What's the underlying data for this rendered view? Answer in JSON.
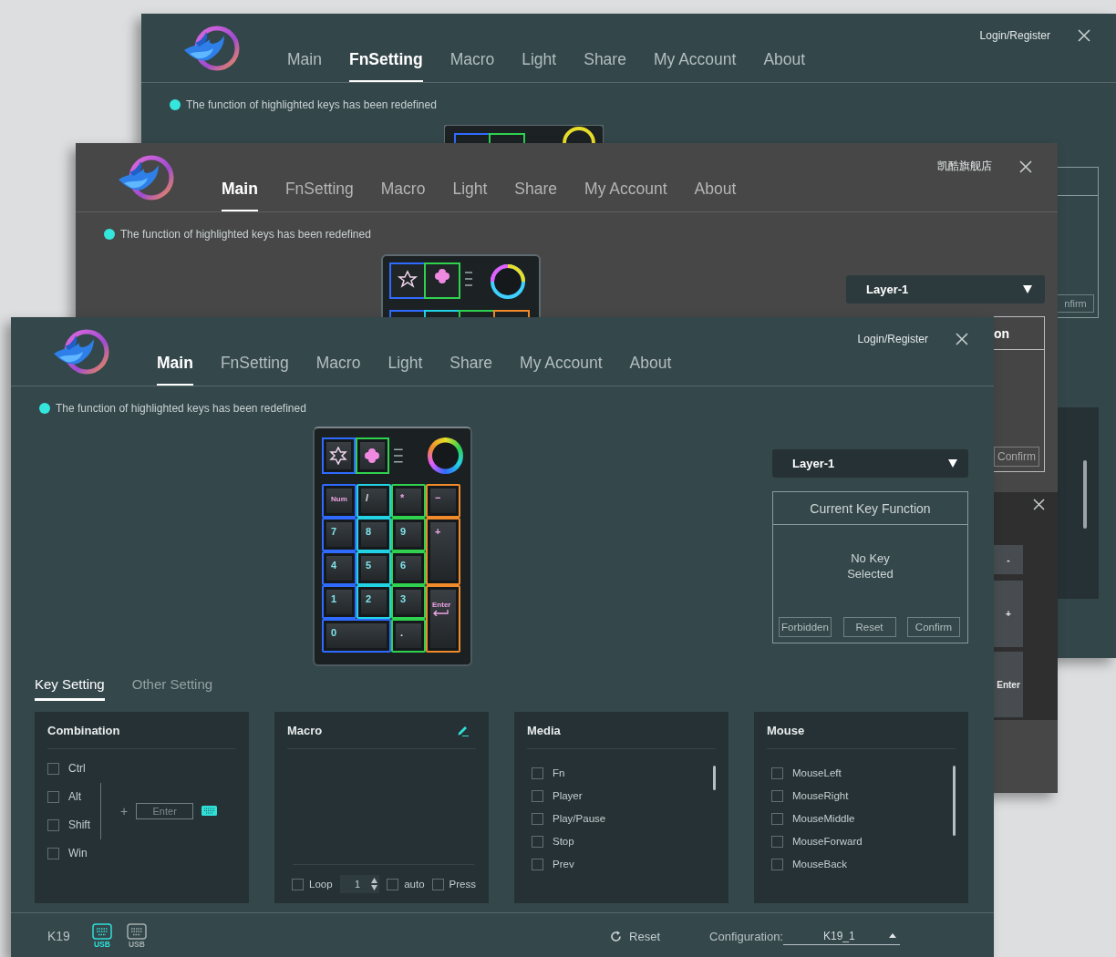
{
  "windows": [
    {
      "kind": "back",
      "tabs": [
        {
          "label": "Main",
          "selected": false
        },
        {
          "label": "FnSetting",
          "selected": true
        },
        {
          "label": "Macro",
          "selected": false
        },
        {
          "label": "Light",
          "selected": false
        },
        {
          "label": "Share",
          "selected": false
        },
        {
          "label": "My Account",
          "selected": false
        },
        {
          "label": "About",
          "selected": false
        }
      ],
      "account_link": "Login/Register",
      "notice": "The function of highlighted keys has been redefined",
      "confirm_button": "nfirm"
    },
    {
      "kind": "middle",
      "tabs": [
        {
          "label": "Main",
          "selected": true
        },
        {
          "label": "FnSetting",
          "selected": false
        },
        {
          "label": "Macro",
          "selected": false
        },
        {
          "label": "Light",
          "selected": false
        },
        {
          "label": "Share",
          "selected": false
        },
        {
          "label": "My Account",
          "selected": false
        },
        {
          "label": "About",
          "selected": false
        }
      ],
      "store_name": "凯酷旗舰店",
      "notice": "The function of highlighted keys has been redefined",
      "layer_select": "Layer-1",
      "key_function_title": "on",
      "confirm_button": "Confirm",
      "popup_keys": [
        "-",
        "+",
        "Enter"
      ]
    },
    {
      "kind": "front",
      "tabs": [
        {
          "label": "Main",
          "selected": true
        },
        {
          "label": "FnSetting",
          "selected": false
        },
        {
          "label": "Macro",
          "selected": false
        },
        {
          "label": "Light",
          "selected": false
        },
        {
          "label": "Share",
          "selected": false
        },
        {
          "label": "My Account",
          "selected": false
        },
        {
          "label": "About",
          "selected": false
        }
      ],
      "account_link": "Login/Register",
      "notice": "The function of highlighted keys has been redefined",
      "keypad": {
        "keys": [
          {
            "label": "Num",
            "kind": "function"
          },
          {
            "label": "/",
            "kind": "symbol"
          },
          {
            "label": "*",
            "kind": "function"
          },
          {
            "label": "−",
            "kind": "function"
          },
          {
            "label": "7",
            "kind": "digit"
          },
          {
            "label": "8",
            "kind": "digit"
          },
          {
            "label": "9",
            "kind": "digit"
          },
          {
            "label": "+",
            "kind": "function"
          },
          {
            "label": "4",
            "kind": "digit"
          },
          {
            "label": "5",
            "kind": "digit"
          },
          {
            "label": "6",
            "kind": "digit"
          },
          {
            "label": "1",
            "kind": "digit"
          },
          {
            "label": "2",
            "kind": "digit"
          },
          {
            "label": "3",
            "kind": "digit"
          },
          {
            "label": "Enter",
            "kind": "function"
          },
          {
            "label": "0",
            "kind": "digit"
          },
          {
            "label": ".",
            "kind": "symbol"
          }
        ]
      },
      "layer_select": "Layer-1",
      "key_function": {
        "title": "Current Key Function",
        "message": "No Key\nSelected",
        "buttons": [
          "Forbidden",
          "Reset",
          "Confirm"
        ]
      },
      "setting_tabs": [
        {
          "label": "Key Setting",
          "selected": true
        },
        {
          "label": "Other Setting",
          "selected": false
        }
      ],
      "combination": {
        "title": "Combination",
        "modifiers": [
          {
            "label": "Ctrl",
            "checked": false
          },
          {
            "label": "Alt",
            "checked": false
          },
          {
            "label": "Shift",
            "checked": false
          },
          {
            "label": "Win",
            "checked": false
          }
        ],
        "join_symbol": "+",
        "key_field": {
          "placeholder": "Enter"
        }
      },
      "macro": {
        "title": "Macro",
        "loop": {
          "label": "Loop",
          "checked": false
        },
        "repeat_count": "1",
        "flags": [
          {
            "label": "auto",
            "checked": false
          },
          {
            "label": "Press",
            "checked": false
          }
        ]
      },
      "media": {
        "title": "Media",
        "items": [
          {
            "label": "Fn",
            "checked": false
          },
          {
            "label": "Player",
            "checked": false
          },
          {
            "label": "Play/Pause",
            "checked": false
          },
          {
            "label": "Stop",
            "checked": false
          },
          {
            "label": "Prev",
            "checked": false
          }
        ]
      },
      "mouse": {
        "title": "Mouse",
        "items": [
          {
            "label": "MouseLeft",
            "checked": false
          },
          {
            "label": "MouseRight",
            "checked": false
          },
          {
            "label": "MouseMiddle",
            "checked": false
          },
          {
            "label": "MouseForward",
            "checked": false
          },
          {
            "label": "MouseBack",
            "checked": false
          }
        ]
      },
      "footer": {
        "device": "K19",
        "connections": [
          {
            "label": "USB",
            "selected": true
          },
          {
            "label": "USB",
            "selected": false
          }
        ],
        "reset_button": "Reset",
        "configuration": {
          "label": "Configuration:",
          "value": "K19_1"
        }
      }
    }
  ]
}
